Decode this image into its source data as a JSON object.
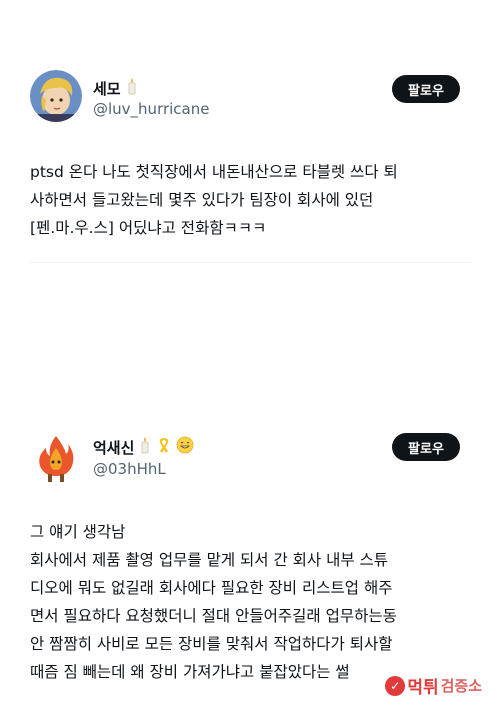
{
  "tweets": [
    {
      "name": "세모",
      "handle": "@luv_hurricane",
      "follow_label": "팔로우",
      "text": "ptsd 온다 나도 첫직장에서 내돈내산으로 타블렛 쓰다 퇴\n사하면서 들고왔는데 몇주 있다가 팀장이 회사에 있던\n[펜.마.우.스] 어딨냐고 전화함ㅋㅋㅋ",
      "avatar_icon": "anime-character-avatar",
      "badges": [
        "candle-icon"
      ]
    },
    {
      "name": "억새신",
      "handle": "@03hHhL",
      "follow_label": "팔로우",
      "text": "그 얘기 생각남\n회사에서 제품 촬영 업무를 맡게 되서 간 회사 내부 스튜\n디오에 뭐도 없길래 회사에다 필요한 장비 리스트업 해주\n면서 필요하다 요청했더니 절대 안들어주길래 업무하는동\n안 짬짬히 사비로 모든 장비를 맞춰서 작업하다가 퇴사할\n때즘 짐 빼는데 왜 장비 가져가냐고 붙잡았다는 썰",
      "avatar_icon": "flame-character-avatar",
      "badges": [
        "candle-icon",
        "yellow-ribbon-icon",
        "grinning-face-icon"
      ]
    }
  ],
  "watermark": {
    "text": "먹튀",
    "sub": "검증소"
  },
  "colors": {
    "button_bg": "#0f1419",
    "handle": "#536471",
    "watermark": "#e03c3c"
  }
}
